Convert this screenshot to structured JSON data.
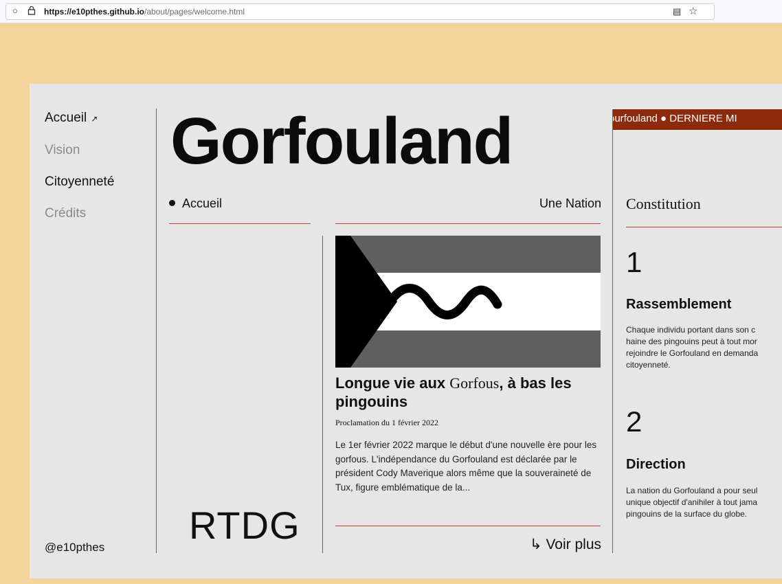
{
  "browser": {
    "url_host": "https://e10pthes.github.io",
    "url_path": "/about/pages/welcome.html"
  },
  "nav": {
    "items": [
      {
        "label": "Accueil",
        "active": true,
        "arrow": "↗"
      },
      {
        "label": "Vision",
        "active": false
      },
      {
        "label": "Citoyenneté",
        "active": true
      },
      {
        "label": "Crédits",
        "active": false
      }
    ],
    "handle": "@e10pthes"
  },
  "header": {
    "title": "Gorfouland",
    "section_left": "Accueil",
    "section_right": "Une Nation"
  },
  "logo_text": "RTDG",
  "article": {
    "title_part1": "Longue vie aux ",
    "title_serif": "Gorfous",
    "title_part2": ", à bas les pingouins",
    "meta": "Proclamation du 1 février 2022",
    "body": "Le 1er février 2022 marque le début d'une nouvelle ère pour les gorfous. L'indépendance du Gorfouland est déclarée par le président Cody Maverique alors même que la souveraineté de Tux, figure emblématique de la...",
    "more_label": "Voir plus",
    "more_icon": "↳"
  },
  "ticker": {
    "text": "ourfouland  ●  DERNIERE MI"
  },
  "constitution": {
    "title": "Constitution",
    "articles": [
      {
        "number": "1",
        "heading": "Rassemblement",
        "text": "Chaque individu portant dans son c\nhaine des pingouins peut à tout mor\nrejoindre le Gorfouland en demanda\ncitoyenneté."
      },
      {
        "number": "2",
        "heading": "Direction",
        "text": "La nation du Gorfouland a pour seul\nunique objectif d'anihiler à tout jama\npingouins de la surface du globe."
      }
    ]
  },
  "colors": {
    "background": "#f2d49c",
    "card": "#e6e6e6",
    "accent": "#b14a2c",
    "ticker": "#8e2a0c"
  }
}
